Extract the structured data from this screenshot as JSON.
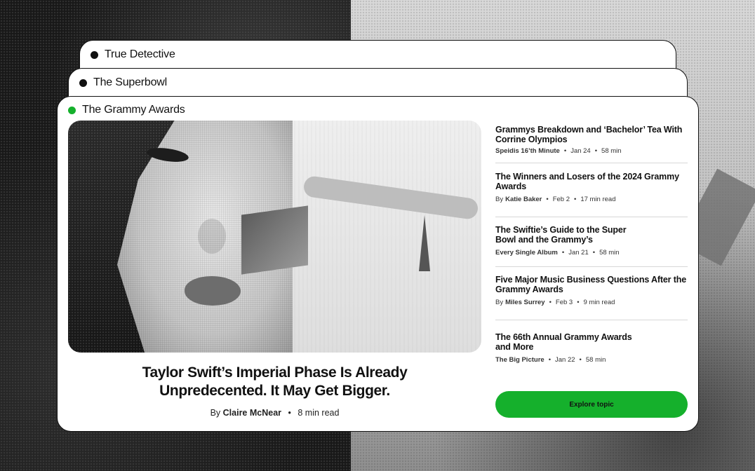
{
  "tabs": [
    {
      "label": "True Detective",
      "active": false
    },
    {
      "label": "The Superbowl",
      "active": false
    },
    {
      "label": "The Grammy Awards",
      "active": true
    }
  ],
  "accent_color": "#15b02c",
  "hero": {
    "image_description": "Black and white collage portrait",
    "headline_line1": "Taylor Swift’s Imperial Phase Is Already",
    "headline_line2": "Unpredecented. It May Get Bigger.",
    "byline_prefix": "By",
    "author": "Claire McNear",
    "read_time": "8 min read"
  },
  "articles": [
    {
      "title_line1": "Grammys Breakdown and ‘Bachelor’ Tea With",
      "title_line2": "Corrine Olympios",
      "prefix": "",
      "source": "Speidis 16’th Minute",
      "date": "Jan 24",
      "duration": "58 min"
    },
    {
      "title_line1": "The Winners and Losers of the 2024 Grammy",
      "title_line2": "Awards",
      "prefix": "By",
      "source": "Katie Baker",
      "date": "Feb 2",
      "duration": "17 min read"
    },
    {
      "title_line1": "The Swiftie’s Guide to the Super",
      "title_line2": "Bowl and the Grammy’s",
      "prefix": "",
      "source": "Every Single Album",
      "date": "Jan 21",
      "duration": "58 min"
    },
    {
      "title_line1": "Five Major Music Business Questions After the",
      "title_line2": "Grammy Awards",
      "prefix": "By",
      "source": "Miles Surrey",
      "date": "Feb 3",
      "duration": "9 min read"
    },
    {
      "title_line1": "The 66th Annual Grammy Awards",
      "title_line2": "and More",
      "prefix": "",
      "source": "The Big Picture",
      "date": "Jan 22",
      "duration": "58 min"
    }
  ],
  "explore_button": "Explore topic"
}
